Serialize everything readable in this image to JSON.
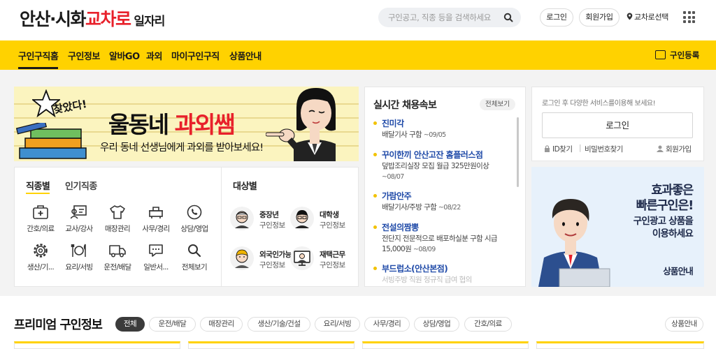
{
  "header": {
    "logo": {
      "part1": "안산·시화",
      "part2": "교차로",
      "part3": " 일자리"
    },
    "search_placeholder": "구인공고, 직종 등을 검색하세요",
    "login": "로그인",
    "signup": "회원가입",
    "region": "교차로선택"
  },
  "nav": {
    "items": [
      "구인구직홈",
      "구인정보",
      "알바GO",
      "과외",
      "마이구인구직",
      "상품안내"
    ],
    "register": "구인등록"
  },
  "banner_tutor": {
    "found": "찾았다!",
    "title_prefix": "울동네 ",
    "title_highlight": "과외쌤",
    "subtitle": "우리 동네 선생님에게 과외를 받아보세요!"
  },
  "categories": {
    "tab_job": "직종별",
    "tab_popular": "인기직종",
    "items": [
      {
        "label": "간호/의료",
        "icon": "medical-kit-icon"
      },
      {
        "label": "교사/강사",
        "icon": "teacher-board-icon"
      },
      {
        "label": "매장관리",
        "icon": "shirt-icon"
      },
      {
        "label": "사무/경리",
        "icon": "office-desk-icon"
      },
      {
        "label": "상담/영업",
        "icon": "phone-call-icon"
      },
      {
        "label": "생산/기...",
        "icon": "gear-icon"
      },
      {
        "label": "요리/서빙",
        "icon": "dish-icon"
      },
      {
        "label": "운전/배달",
        "icon": "truck-icon"
      },
      {
        "label": "일반서...",
        "icon": "chat-bubble-icon"
      },
      {
        "label": "전체보기",
        "icon": "search-icon"
      }
    ]
  },
  "targets": {
    "title": "대상별",
    "items": [
      {
        "line1": "중장년",
        "line2": "구인정보"
      },
      {
        "line1": "대학생",
        "line2": "구인정보"
      },
      {
        "line1": "외국인가능",
        "line2": "구인정보"
      },
      {
        "line1": "재택근무",
        "line2": "구인정보"
      }
    ]
  },
  "realtime": {
    "title": "실시간 채용속보",
    "view_all": "전체보기",
    "jobs": [
      {
        "company": "진미각",
        "desc": "배달기사 구함",
        "date": "~09/05"
      },
      {
        "company": "꾸이한끼 안산고잔 홈플러스점",
        "desc": "덮밥조리실장 모집 월급 325만원이상",
        "date": "~08/07"
      },
      {
        "company": "가람안주",
        "desc": "배달기사/주방 구함",
        "date": "~08/22"
      },
      {
        "company": "전설의짬뽕",
        "desc": "전단지 전문적으로 배포하실분 구함 시급 15,000원",
        "date": "~08/09"
      },
      {
        "company": "부드럽소(안산본점)",
        "desc": "서빙주방 직원 정규직 급여 협의",
        "date": ""
      }
    ]
  },
  "login_box": {
    "hint": "로그인 후 다양한 서비스를이용해 보세요!",
    "button": "로그인",
    "find_id": "ID찾기",
    "find_pw": "비밀번호찾기",
    "join": "회원가입"
  },
  "banner_ad": {
    "line1": "효과좋은",
    "line2": "빠른구인은!",
    "line3": "구인광고 상품을",
    "line4": "이용하세요",
    "button": "상품안내"
  },
  "premium": {
    "title": "프리미엄 구인정보",
    "chips": [
      "전체",
      "운전/배달",
      "매장관리",
      "생산/기술/건설",
      "요리/서빙",
      "사무/경리",
      "상담/영업",
      "간호/의료"
    ],
    "product_btn": "상품안내"
  },
  "colors": {
    "brand_yellow": "#ffd200",
    "brand_red": "#e8212b",
    "link_blue": "#1f4aa8"
  }
}
